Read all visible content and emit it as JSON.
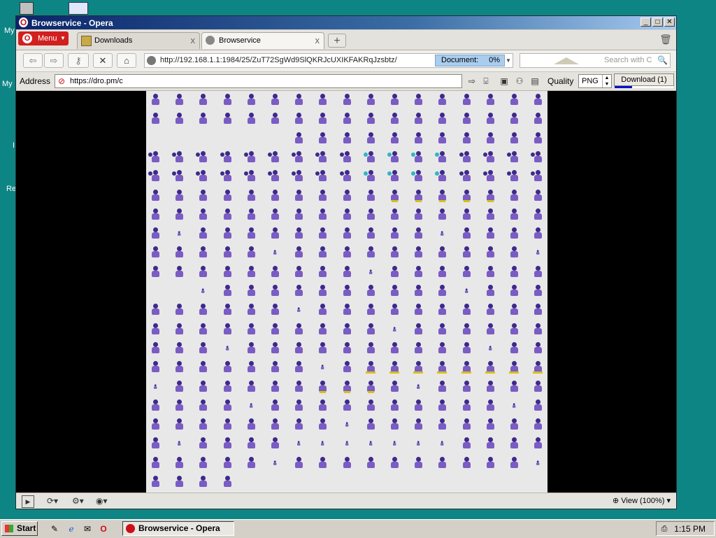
{
  "desktop": {
    "icons": [
      {
        "label": "My"
      },
      {
        "label": "My"
      },
      {
        "label": "I"
      },
      {
        "label": "Re"
      }
    ]
  },
  "window": {
    "title": "Browservice - Opera",
    "controls": {
      "minimize": "_",
      "maximize": "□",
      "close": "✕"
    }
  },
  "tabs": {
    "menu_label": "Menu",
    "items": [
      {
        "label": "Downloads",
        "close": "x"
      },
      {
        "label": "Browservice",
        "close": "x"
      }
    ],
    "new_tab": "+"
  },
  "navbar": {
    "url": "http://192.168.1.1:1984/25/ZuT72SgWd9SlQKRJcUXIKFAKRqJzsbtz/",
    "document_label": "Document:",
    "document_progress": "0%",
    "search_placeholder": "Search with C"
  },
  "addressbar": {
    "label": "Address",
    "value": "https://dro.pm/c",
    "quality_label": "Quality",
    "quality_value": "PNG",
    "download_label": "Download (1)",
    "download_progress": 0.3
  },
  "statusbar": {
    "view_label": "View (100%)"
  },
  "taskbar": {
    "start_label": "Start",
    "task_label": "Browservice - Opera",
    "clock": "1:15 PM"
  },
  "colors": {
    "desktop": "#0e8585",
    "sprite_main": "#7a5cc4",
    "sprite_accent": "#3d2a8a",
    "sprite_yellow": "#d8c21a",
    "sprite_cyan": "#2fb5c8"
  }
}
